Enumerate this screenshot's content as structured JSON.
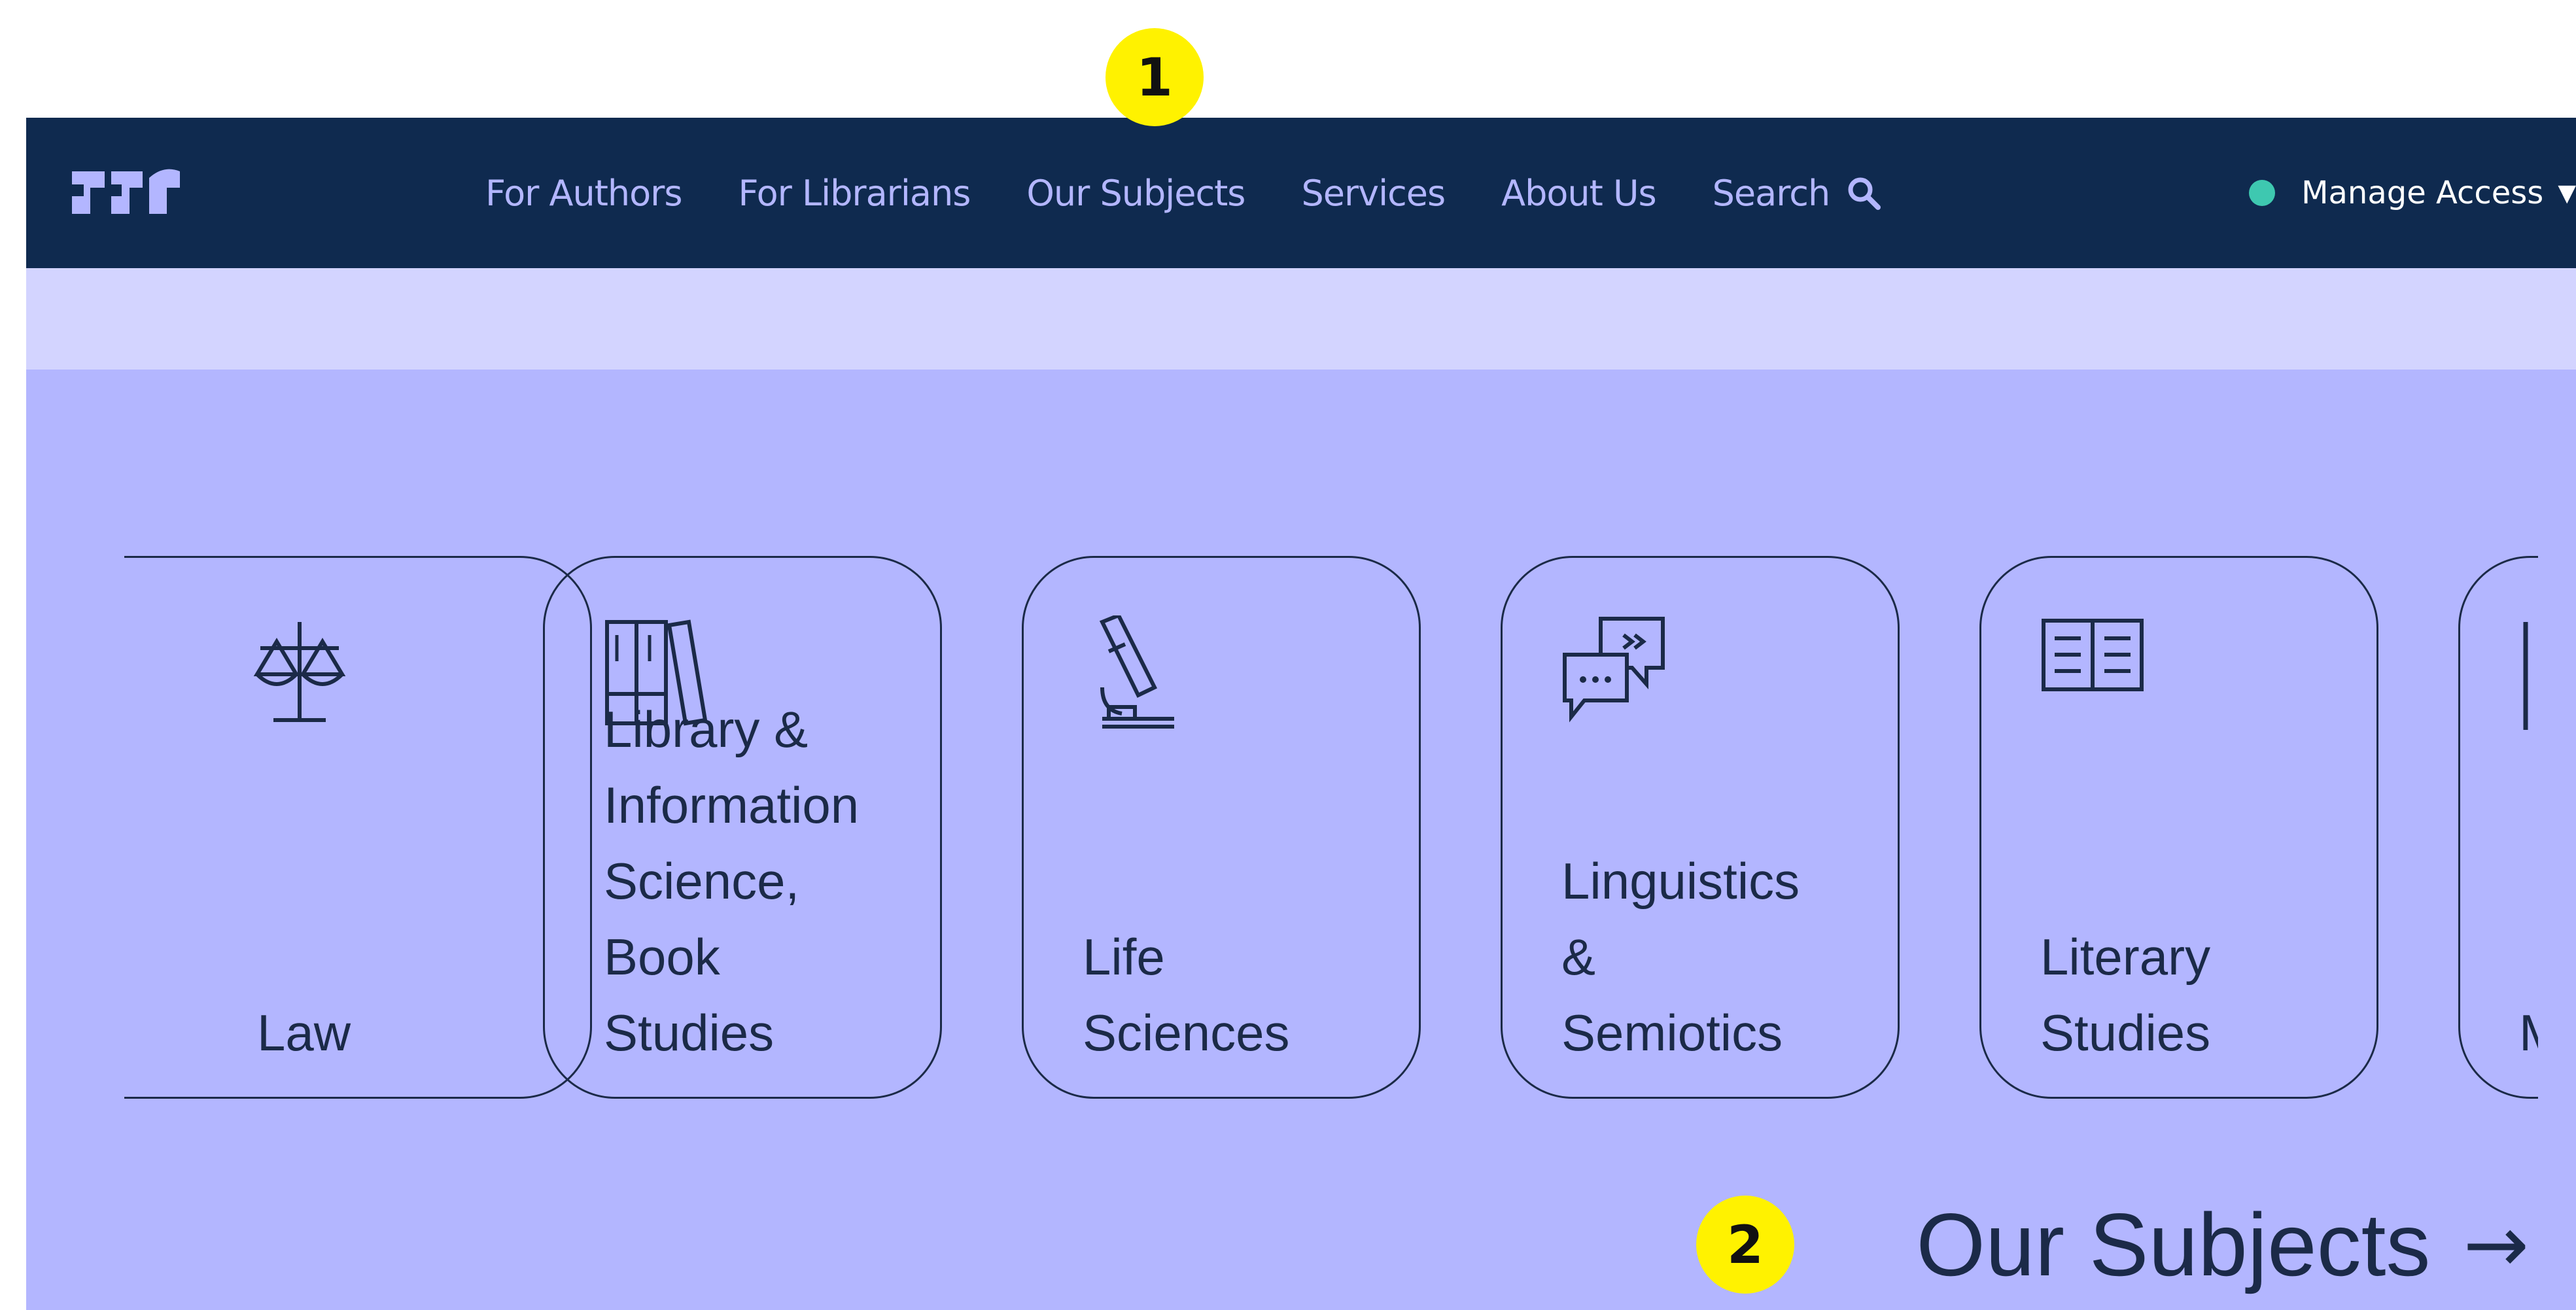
{
  "annotations": {
    "badge_1": "1",
    "badge_2": "2"
  },
  "navbar": {
    "logo_icon": "publisher-logo",
    "links": [
      {
        "label": "For Authors"
      },
      {
        "label": "For Librarians"
      },
      {
        "label": "Our Subjects"
      },
      {
        "label": "Services"
      },
      {
        "label": "About Us"
      }
    ],
    "search_label": "Search",
    "manage_access_label": "Manage Access",
    "status_dot_color": "#3ec8b0"
  },
  "subjects": [
    {
      "label": "Law",
      "icon": "scales-icon"
    },
    {
      "label": "Library &\nInformation\nScience,\nBook\nStudies",
      "icon": "books-icon"
    },
    {
      "label": "Life\nSciences",
      "icon": "microscope-icon"
    },
    {
      "label": "Linguistics\n&\nSemiotics",
      "icon": "speech-bubbles-icon"
    },
    {
      "label": "Literary\nStudies",
      "icon": "open-book-icon"
    },
    {
      "label": "M",
      "icon": "partial-icon"
    }
  ],
  "footer_link": {
    "label": "Our Subjects",
    "arrow": "→"
  },
  "colors": {
    "navbar_bg": "#0f2a4f",
    "nav_text": "#b3b6ff",
    "strip_bg": "#d3d4ff",
    "main_bg": "#b3b6ff",
    "ink": "#1b2a48",
    "badge": "#fff200"
  }
}
